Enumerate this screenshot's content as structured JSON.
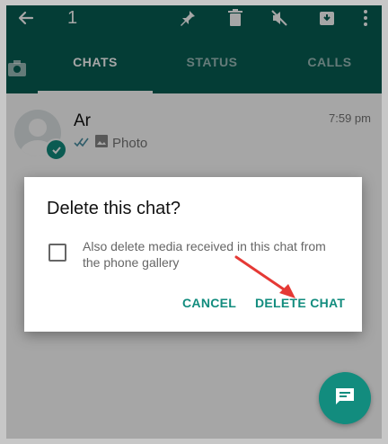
{
  "toolbar": {
    "selected_count": "1"
  },
  "tabs": [
    {
      "label": "CHATS"
    },
    {
      "label": "STATUS"
    },
    {
      "label": "CALLS"
    }
  ],
  "chat": {
    "name": "Ar",
    "time": "7:59 pm",
    "preview": "Photo"
  },
  "dialog": {
    "title": "Delete this chat?",
    "checkbox_label": "Also delete media received in this chat from the phone gallery",
    "cancel_label": "CANCEL",
    "delete_label": "DELETE CHAT"
  },
  "icons": {
    "back": "arrow-left-icon",
    "pin": "pin-icon",
    "delete": "trash-icon",
    "mute": "mute-icon",
    "archive": "archive-icon",
    "more": "more-vertical-icon",
    "camera": "camera-icon",
    "new_chat": "chat-icon"
  },
  "colors": {
    "header": "#075e54",
    "accent": "#128c7e",
    "arrow": "#e53935"
  }
}
